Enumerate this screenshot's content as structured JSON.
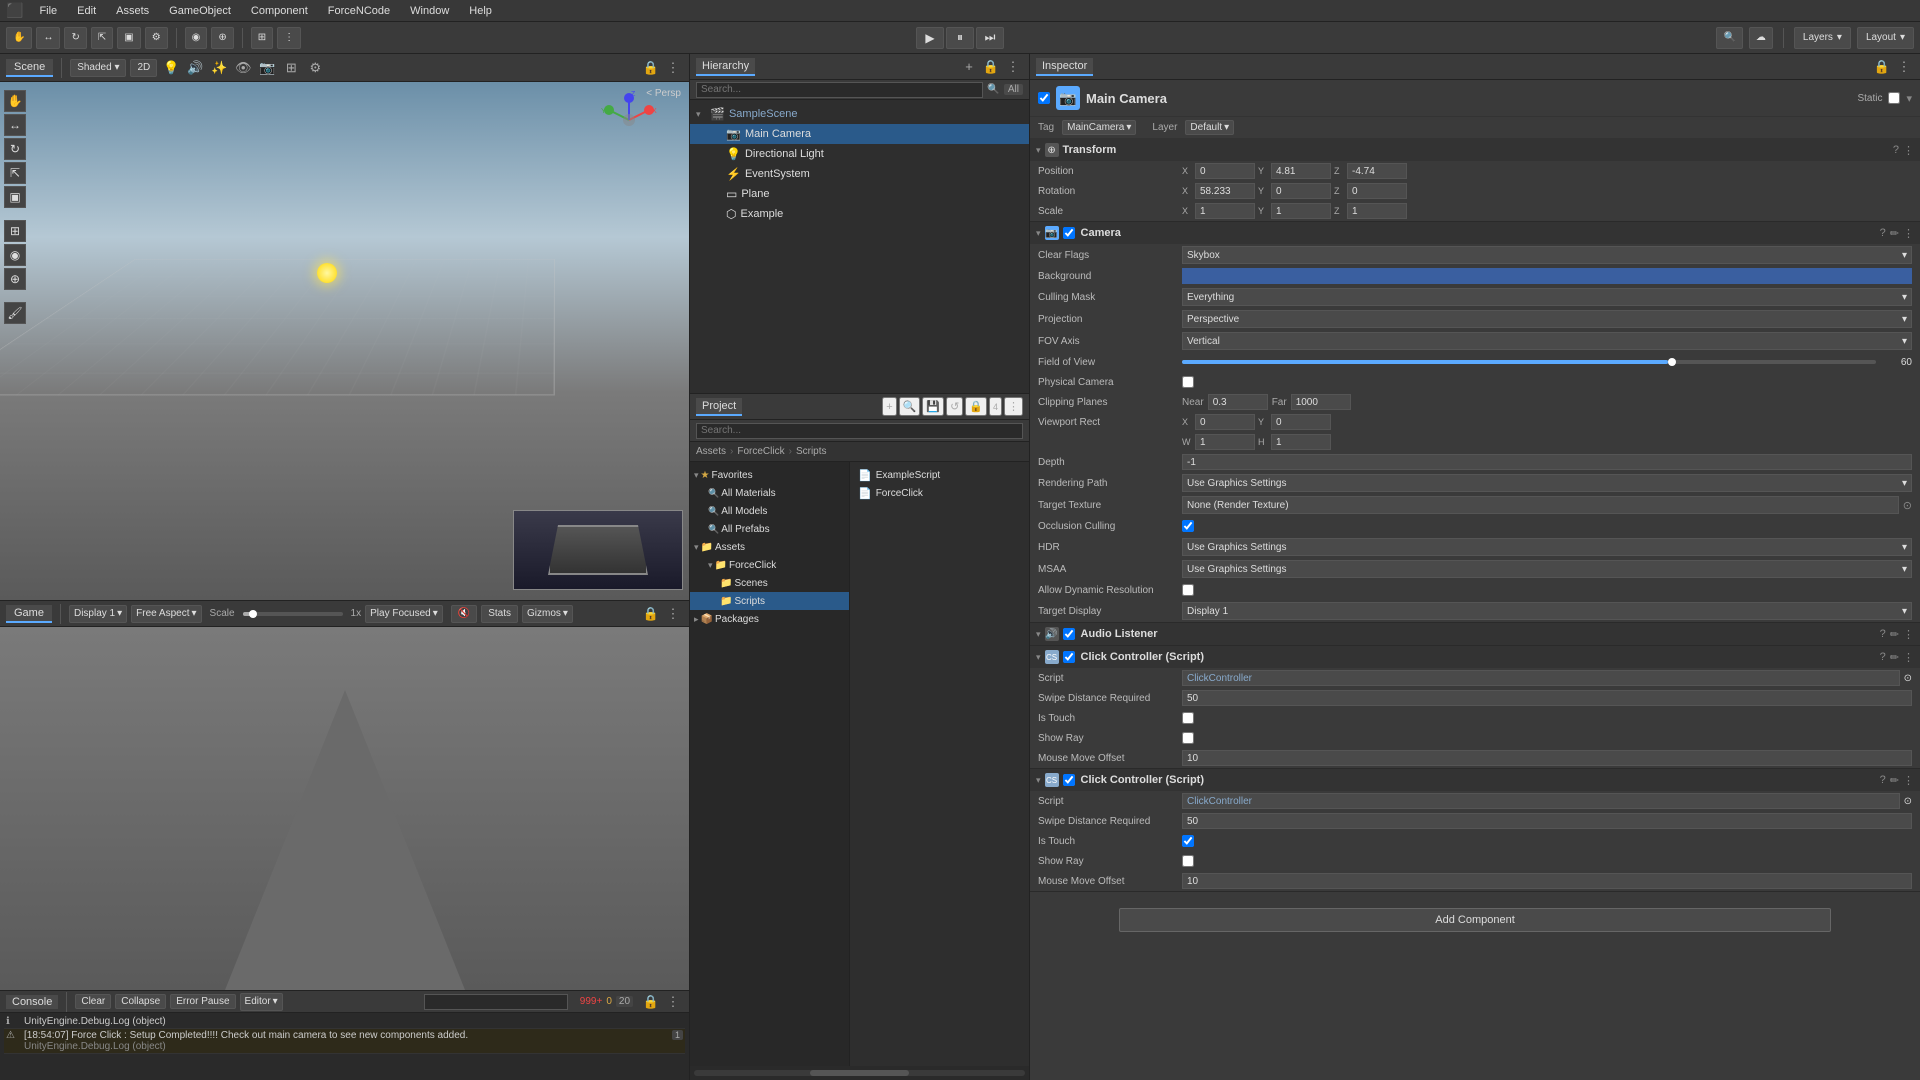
{
  "menu": {
    "items": [
      "File",
      "Edit",
      "Assets",
      "GameObject",
      "Component",
      "ForceNCode",
      "Window",
      "Help"
    ]
  },
  "toolbar": {
    "play_btn": "▶",
    "pause_btn": "⏸",
    "step_btn": "⏭",
    "layers_label": "Layers",
    "layout_label": "Layout"
  },
  "scene": {
    "tab": "Scene",
    "persp": "< Persp",
    "tools": [
      "✋",
      "↔",
      "↻",
      "⇱",
      "▣",
      "⚙"
    ],
    "mode_2d": "2D"
  },
  "game": {
    "tab": "Game",
    "display_label": "Display 1",
    "aspect_label": "Free Aspect",
    "scale_label": "Scale",
    "scale_value": "1x",
    "play_focused_label": "Play Focused",
    "stats_label": "Stats",
    "gizmos_label": "Gizmos"
  },
  "hierarchy": {
    "tab": "Hierarchy",
    "scene_name": "SampleScene",
    "items": [
      {
        "name": "Main Camera",
        "type": "camera",
        "selected": true,
        "depth": 1
      },
      {
        "name": "Directional Light",
        "type": "light",
        "selected": false,
        "depth": 1
      },
      {
        "name": "EventSystem",
        "type": "object",
        "selected": false,
        "depth": 1
      },
      {
        "name": "Plane",
        "type": "object",
        "selected": false,
        "depth": 1
      },
      {
        "name": "Example",
        "type": "object",
        "selected": false,
        "depth": 1
      }
    ]
  },
  "project": {
    "tab": "Project",
    "breadcrumb": [
      "Assets",
      "ForceClick",
      "Scripts"
    ],
    "favorites": {
      "label": "Favorites",
      "items": [
        "All Materials",
        "All Models",
        "All Prefabs"
      ]
    },
    "assets": {
      "label": "Assets",
      "items": [
        {
          "name": "ForceClick",
          "type": "folder",
          "depth": 1,
          "children": [
            {
              "name": "Scenes",
              "type": "folder",
              "depth": 2
            },
            {
              "name": "Scripts",
              "type": "folder",
              "depth": 2
            }
          ]
        }
      ]
    },
    "packages": {
      "label": "Packages"
    },
    "files": [
      {
        "name": "ExampleScript",
        "type": "script"
      },
      {
        "name": "ForceClick",
        "type": "script"
      }
    ]
  },
  "inspector": {
    "tab": "Inspector",
    "object_name": "Main Camera",
    "tag": "MainCamera",
    "layer": "Default",
    "transform": {
      "title": "Transform",
      "position": {
        "x": "0",
        "y": "4.81",
        "z": "-4.74"
      },
      "rotation": {
        "x": "58.233",
        "y": "0",
        "z": "0"
      },
      "scale": {
        "x": "1",
        "y": "1",
        "z": "1"
      }
    },
    "camera": {
      "title": "Camera",
      "clear_flags": "Skybox",
      "background_color": "#3a5fa0",
      "culling_mask": "Everything",
      "projection": "Perspective",
      "fov_axis": "Vertical",
      "field_of_view": "60",
      "fov_percent": 70,
      "physical_camera": false,
      "clipping_near": "0.3",
      "clipping_far": "1000",
      "viewport_x": "0",
      "viewport_y": "0",
      "viewport_w": "1",
      "viewport_h": "1",
      "depth": "-1",
      "rendering_path": "Use Graphics Settings",
      "target_texture": "None (Render Texture)",
      "occlusion_culling": true,
      "hdr": "Use Graphics Settings",
      "msaa": "Use Graphics Settings",
      "allow_dynamic_res": false,
      "target_display": "Display 1"
    },
    "audio_listener": {
      "title": "Audio Listener"
    },
    "click_controller_1": {
      "title": "Click Controller (Script)",
      "script": "ClickController",
      "swipe_distance": "50",
      "is_touch": false,
      "show_ray": false,
      "mouse_move_offset": "10"
    },
    "click_controller_2": {
      "title": "Click Controller (Script)",
      "script": "ClickController",
      "swipe_distance": "50",
      "is_touch": true,
      "show_ray": false,
      "mouse_move_offset": "10"
    },
    "add_component": "Add Component"
  },
  "console": {
    "tab": "Console",
    "buttons": [
      "Clear",
      "Collapse",
      "Error Pause",
      "Editor"
    ],
    "messages": [
      {
        "type": "info",
        "text": "UnityEngine.Debug.Log (object)",
        "count": null
      },
      {
        "type": "warn",
        "text": "[18:54:07] Force Click : Setup Completed!!!! Check out main camera to see new components added.",
        "sub": "UnityEngine.Debug.Log (object)",
        "count": "1"
      }
    ],
    "error_count": "999+",
    "warning_count": "0",
    "log_count": "20"
  }
}
